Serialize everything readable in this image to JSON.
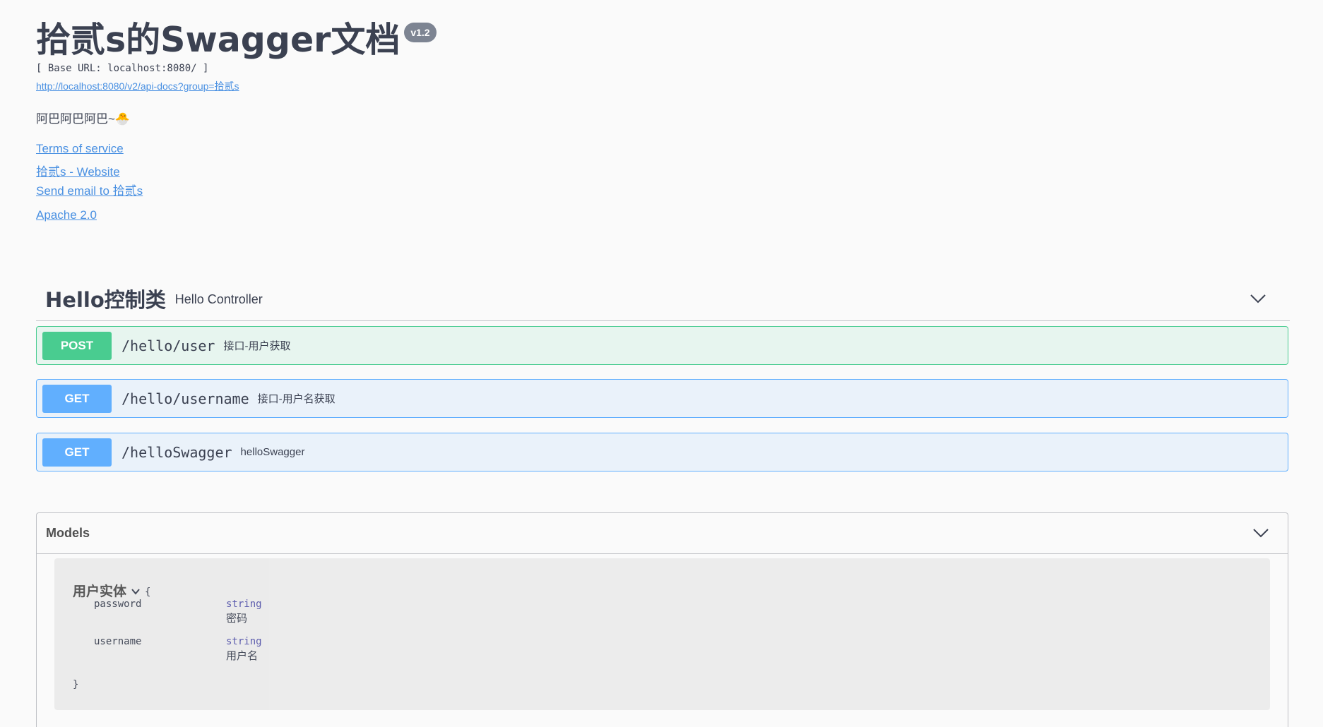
{
  "info": {
    "title": "拾贰s的Swagger文档",
    "version": "v1.2",
    "base_url": "[ Base URL: localhost:8080/ ]",
    "api_docs_link": "http://localhost:8080/v2/api-docs?group=拾贰s",
    "description": "阿巴阿巴阿巴~🐣",
    "terms_of_service": "Terms of service",
    "website_link": "拾贰s - Website",
    "email_link": "Send email to 拾贰s",
    "license_link": "Apache 2.0"
  },
  "tag": {
    "name": "Hello控制类",
    "description": "Hello Controller",
    "chevron_icon": "chevron-down-icon"
  },
  "operations": [
    {
      "method": "POST",
      "path": "/hello/user",
      "summary": "接口-用户获取",
      "color": "#49cc90"
    },
    {
      "method": "GET",
      "path": "/hello/username",
      "summary": "接口-用户名获取",
      "color": "#61affe"
    },
    {
      "method": "GET",
      "path": "/helloSwagger",
      "summary": "helloSwagger",
      "color": "#61affe"
    }
  ],
  "models": {
    "title": "Models",
    "chevron_icon": "chevron-down-icon",
    "model": {
      "name": "用户实体",
      "open_brace": "{",
      "close_brace": "}",
      "properties": [
        {
          "name": "password",
          "type": "string",
          "description": "密码"
        },
        {
          "name": "username",
          "type": "string",
          "description": "用户名"
        }
      ]
    }
  }
}
